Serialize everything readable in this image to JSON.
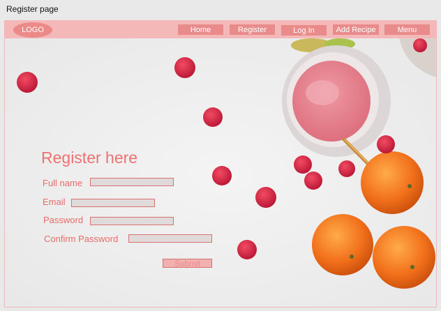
{
  "window": {
    "title": "Register page"
  },
  "navbar": {
    "logo": "LOGO",
    "items": [
      {
        "label": "Home"
      },
      {
        "label": "Register"
      },
      {
        "label": "Log In"
      },
      {
        "label": "Add Recipe"
      },
      {
        "label": "Menu"
      }
    ]
  },
  "form": {
    "title": "Register here",
    "fields": [
      {
        "label": "Full name",
        "value": ""
      },
      {
        "label": "Email",
        "value": ""
      },
      {
        "label": "Password",
        "value": ""
      },
      {
        "label": "Confirm Password",
        "value": ""
      }
    ],
    "submit_label": "Submit"
  },
  "colors": {
    "accent": "#ec7272",
    "navbar": "#f5b8b8",
    "button": "#ea8b8b"
  }
}
